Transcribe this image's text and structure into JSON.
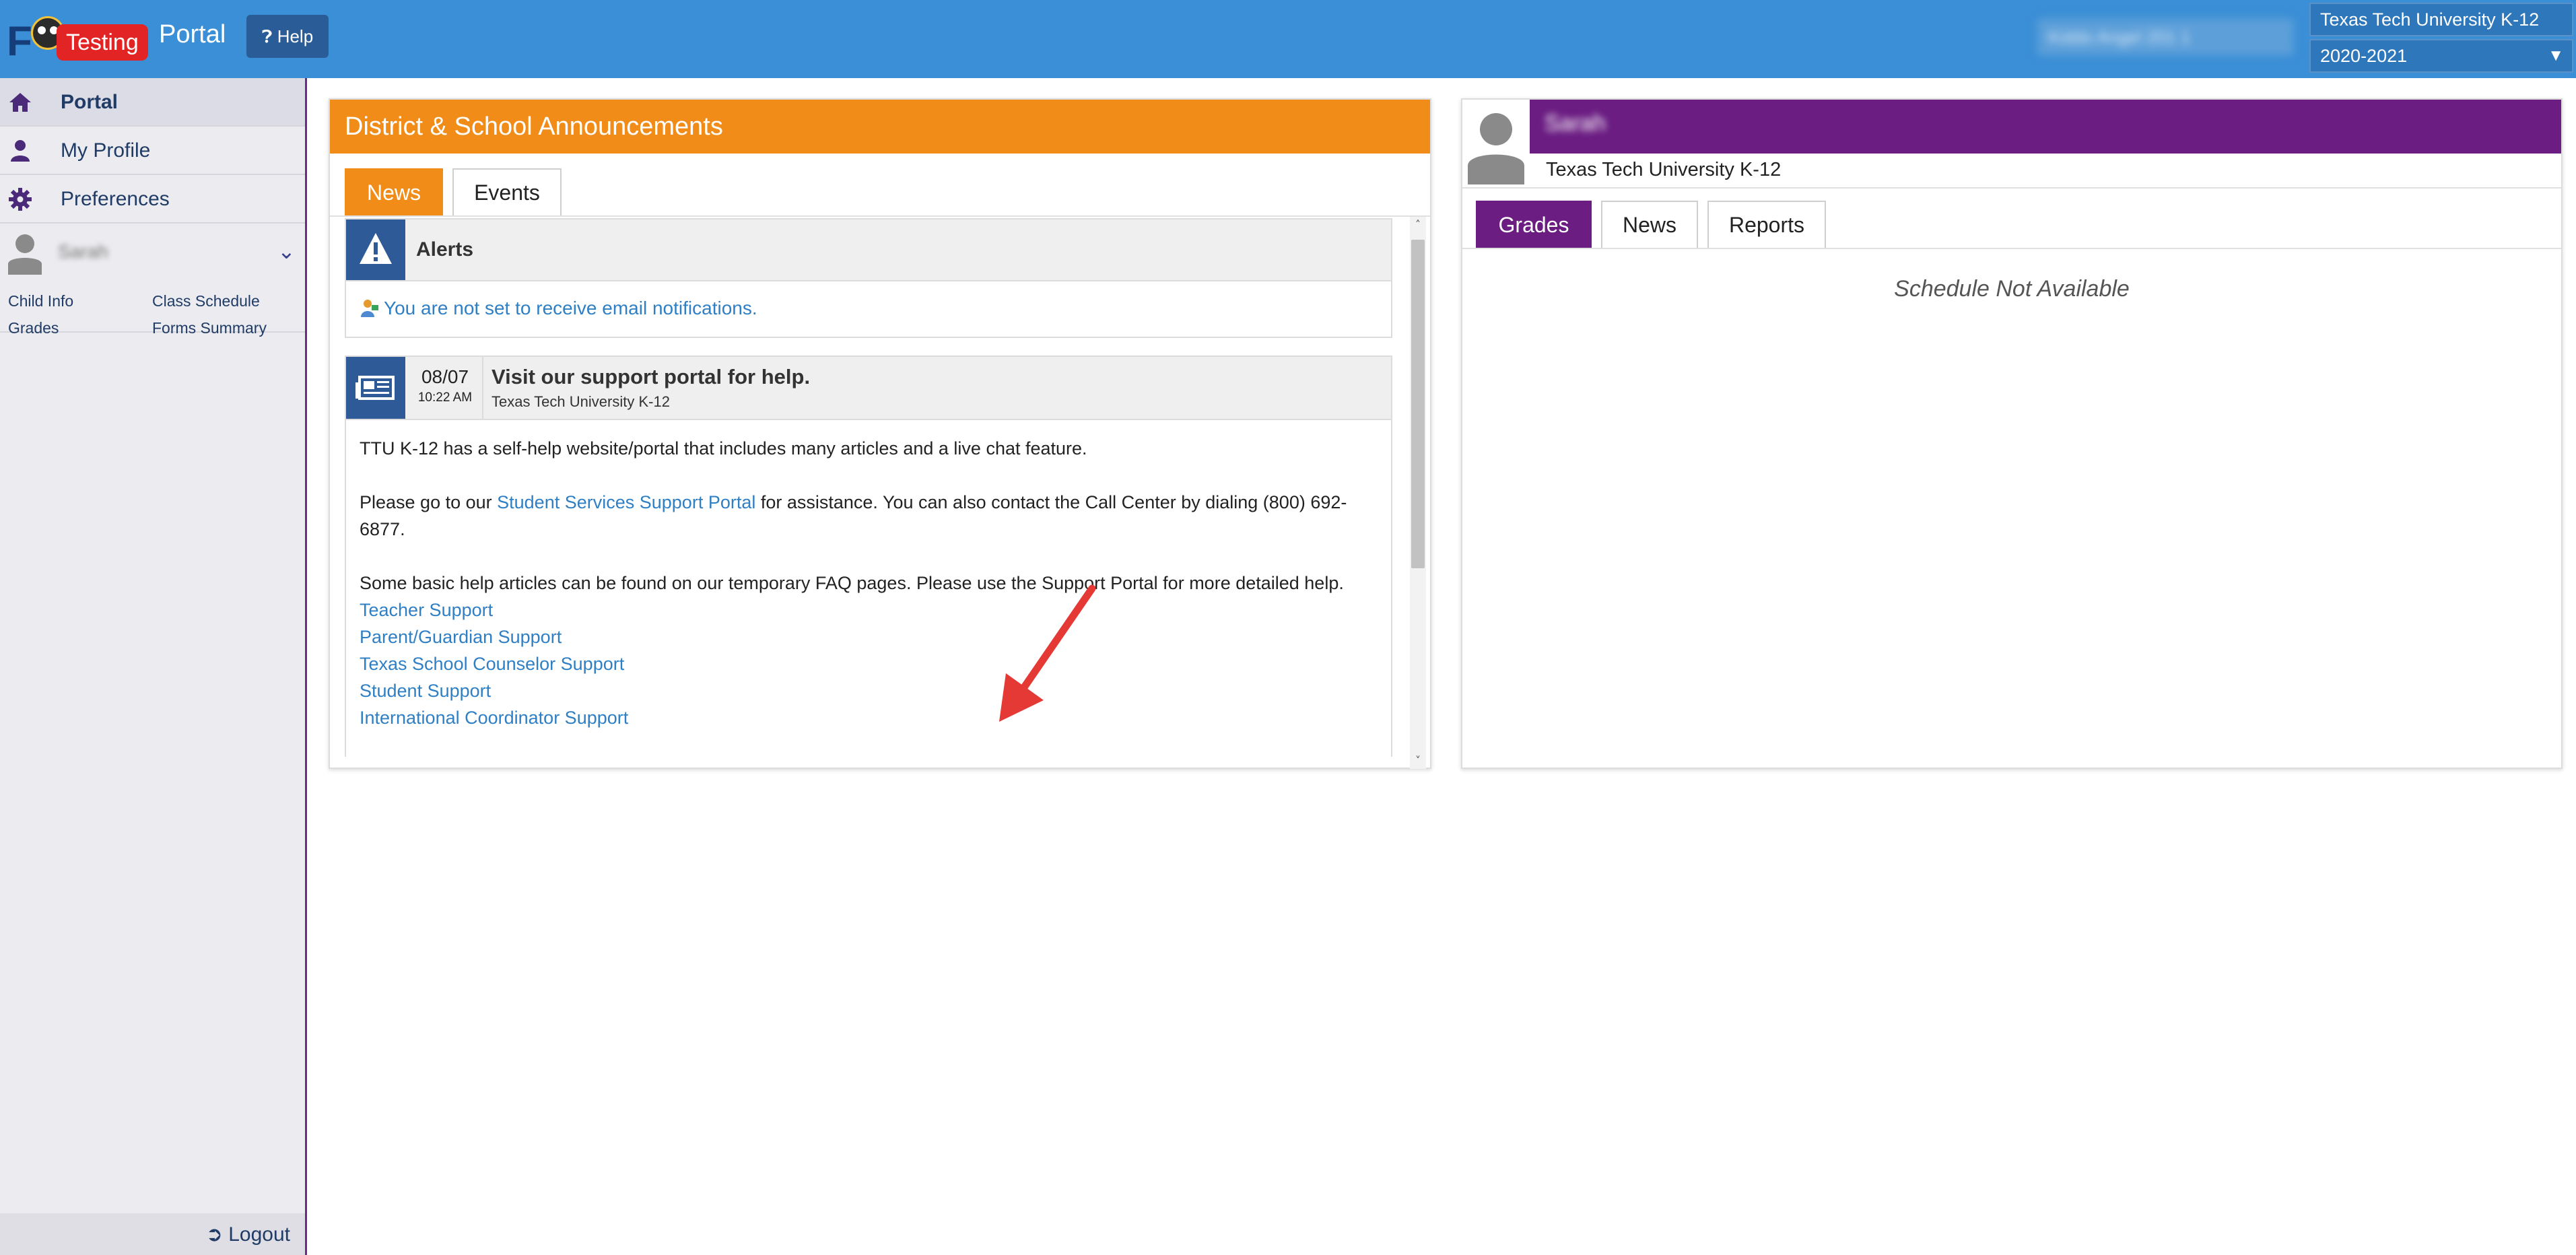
{
  "header": {
    "logo_letter": "F",
    "environment_badge": "Testing",
    "app_title": "Portal",
    "help_label": "Help",
    "user_menu_label": "Kiddo Angel 201 1",
    "school_select": "Texas Tech University K-12",
    "year_select": "2020-2021"
  },
  "sidebar": {
    "nav": [
      {
        "label": "Portal",
        "icon": "home-icon"
      },
      {
        "label": "My Profile",
        "icon": "user-icon"
      },
      {
        "label": "Preferences",
        "icon": "gear-icon"
      }
    ],
    "child": {
      "name": "Sarah",
      "links": [
        "Child Info",
        "Class Schedule",
        "Grades",
        "Forms Summary"
      ]
    },
    "logout_label": "Logout"
  },
  "announcements": {
    "title": "District & School Announcements",
    "tabs": [
      "News",
      "Events"
    ],
    "alerts": {
      "title": "Alerts",
      "message": "You are not set to receive email notifications."
    },
    "news_item": {
      "date": "08/07",
      "time": "10:22 AM",
      "title": "Visit our support portal for help.",
      "source": "Texas Tech University K-12",
      "para1": "TTU K-12 has a self-help website/portal that includes many articles and a live chat feature.",
      "para2_before": "Please go to our ",
      "para2_link": "Student Services Support Portal",
      "para2_after": " for assistance. You can also contact the Call Center by dialing (800) 692-6877.",
      "para3": "Some basic help articles can be found on our temporary FAQ pages. Please use the Support Portal for more detailed help.",
      "links": [
        "Teacher Support",
        "Parent/Guardian Support",
        "Texas School Counselor Support",
        "Student Support",
        "International Coordinator Support"
      ]
    }
  },
  "student": {
    "name": "Sarah",
    "school": "Texas Tech University K-12",
    "tabs": [
      "Grades",
      "News",
      "Reports"
    ],
    "empty_message": "Schedule Not Available"
  },
  "colors": {
    "topbar": "#3b8fd6",
    "accent_orange": "#f08c17",
    "accent_purple": "#6b1d82",
    "link_blue": "#2f7fc4",
    "badge_red": "#e32424"
  }
}
